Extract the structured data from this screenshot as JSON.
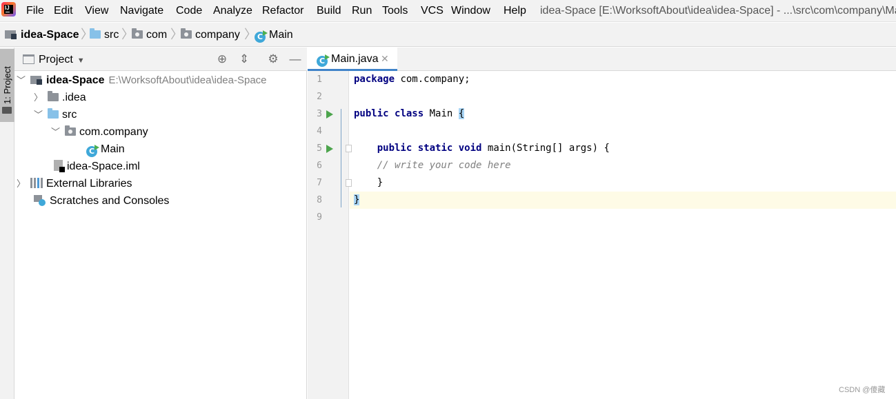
{
  "menubar": {
    "items": [
      "File",
      "Edit",
      "View",
      "Navigate",
      "Code",
      "Analyze",
      "Refactor",
      "Build",
      "Run",
      "Tools",
      "VCS",
      "Window",
      "Help"
    ],
    "window_title": "idea-Space [E:\\WorksoftAbout\\idea\\idea-Space] - ...\\src\\com\\company\\Main.java"
  },
  "breadcrumb": [
    "idea-Space",
    "src",
    "com",
    "company",
    "Main"
  ],
  "side_strip": {
    "project_tab": "1: Project"
  },
  "project_panel": {
    "title": "Project",
    "tree": [
      {
        "label": "idea-Space",
        "path": "E:\\WorksoftAbout\\idea\\idea-Space",
        "icon": "project-folder-icon"
      },
      {
        "label": ".idea",
        "icon": "folder-icon"
      },
      {
        "label": "src",
        "icon": "source-folder-icon"
      },
      {
        "label": "com.company",
        "icon": "package-icon"
      },
      {
        "label": "Main",
        "icon": "java-class-icon"
      },
      {
        "label": "idea-Space.iml",
        "icon": "iml-file-icon"
      },
      {
        "label": "External Libraries",
        "icon": "libraries-icon"
      },
      {
        "label": "Scratches and Consoles",
        "icon": "scratches-icon"
      }
    ]
  },
  "editor": {
    "tab": {
      "label": "Main.java"
    },
    "line_numbers": [
      "1",
      "2",
      "3",
      "4",
      "5",
      "6",
      "7",
      "8",
      "9"
    ],
    "code": {
      "l1_kw": "package",
      "l1_rest": " com.company;",
      "l3_kw1": "public",
      "l3_kw2": "class",
      "l3_name": " Main ",
      "l3_brace": "{",
      "l5_indent": "    ",
      "l5_kw1": "public",
      "l5_kw2": "static",
      "l5_kw3": "void",
      "l5_rest": " main(String[] args) {",
      "l6_comment": "    // write your code here",
      "l7_text": "    }",
      "l8_brace": "}"
    }
  },
  "watermark": "CSDN @傻藏",
  "colors": {
    "keyword": "#000080",
    "comment": "#808080",
    "current_line": "#fefbe6",
    "accent": "#4083c9"
  }
}
